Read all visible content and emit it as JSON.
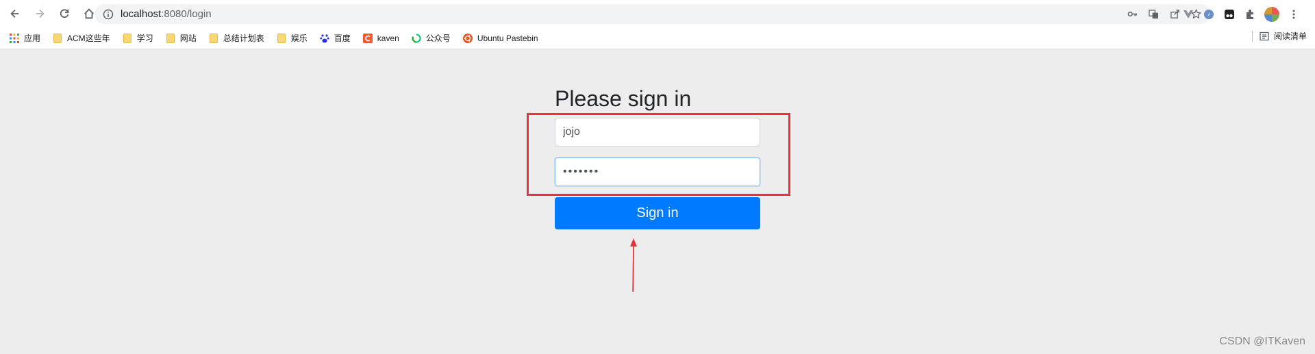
{
  "browser": {
    "url_host": "localhost",
    "url_path": ":8080/login"
  },
  "bookmarks": [
    {
      "label": "应用",
      "icon": "apps-grid-icon"
    },
    {
      "label": "ACM这些年",
      "icon": "folder-icon"
    },
    {
      "label": "学习",
      "icon": "folder-icon"
    },
    {
      "label": "网站",
      "icon": "folder-icon"
    },
    {
      "label": "总结计划表",
      "icon": "folder-icon"
    },
    {
      "label": "娱乐",
      "icon": "folder-icon"
    },
    {
      "label": "百度",
      "icon": "baidu-paw-icon"
    },
    {
      "label": "kaven",
      "icon": "csdn-c-icon"
    },
    {
      "label": "公众号",
      "icon": "wechat-icon"
    },
    {
      "label": "Ubuntu Pastebin",
      "icon": "ubuntu-icon"
    }
  ],
  "reading_list": "阅读清单",
  "login": {
    "heading": "Please sign in",
    "username_value": "jojo",
    "password_value": "•••••••",
    "submit_label": "Sign in"
  },
  "colors": {
    "primary": "#007bff",
    "highlight": "#e8323a",
    "page_bg": "#ededed"
  },
  "watermark": "CSDN @ITKaven"
}
